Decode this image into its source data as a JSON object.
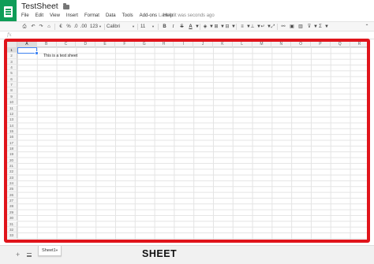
{
  "app": {
    "title": "TestSheet",
    "last_edit": "Last edit was seconds ago",
    "brand_color": "#0f9d58",
    "icons": [
      "sheets-logo-icon",
      "star-icon",
      "folder-icon"
    ]
  },
  "menu": [
    "File",
    "Edit",
    "View",
    "Insert",
    "Format",
    "Data",
    "Tools",
    "Add-ons",
    "Help"
  ],
  "toolbar": {
    "print_icon": "print-icon",
    "undo_icon": "undo-icon",
    "redo_icon": "redo-icon",
    "paint_format_icon": "paint-format-icon",
    "currency": "€",
    "percent": "%",
    "dec_decimals": ".0",
    "inc_decimals": ".00",
    "more_formats": "123",
    "font": "Calibri",
    "font_size": "11",
    "bold": "B",
    "italic": "I",
    "strikethrough": "S",
    "text_color": "A",
    "text_color_value": "#000000"
  },
  "formula_bar": {
    "fx": "fx",
    "value": ""
  },
  "grid": {
    "columns": [
      "A",
      "B",
      "C",
      "D",
      "E",
      "F",
      "G",
      "H",
      "I",
      "J",
      "K",
      "L",
      "M",
      "N",
      "O",
      "P",
      "Q",
      "R"
    ],
    "rows": [
      "1",
      "2",
      "3",
      "4",
      "5",
      "6",
      "7",
      "8",
      "9",
      "10",
      "11",
      "12",
      "13",
      "14",
      "15",
      "16",
      "17",
      "18",
      "19",
      "20",
      "21",
      "22",
      "23",
      "24",
      "25",
      "26",
      "27",
      "28",
      "29",
      "30",
      "31",
      "32",
      "33"
    ],
    "selected_cell": "A1",
    "selection_color": "#4285f4",
    "cells": {
      "B2": "This is a test sheet"
    }
  },
  "sheets": {
    "add_label": "+",
    "tabs": [
      "Sheet1"
    ]
  },
  "caption": "SHEET",
  "highlight_color": "#e0141b"
}
